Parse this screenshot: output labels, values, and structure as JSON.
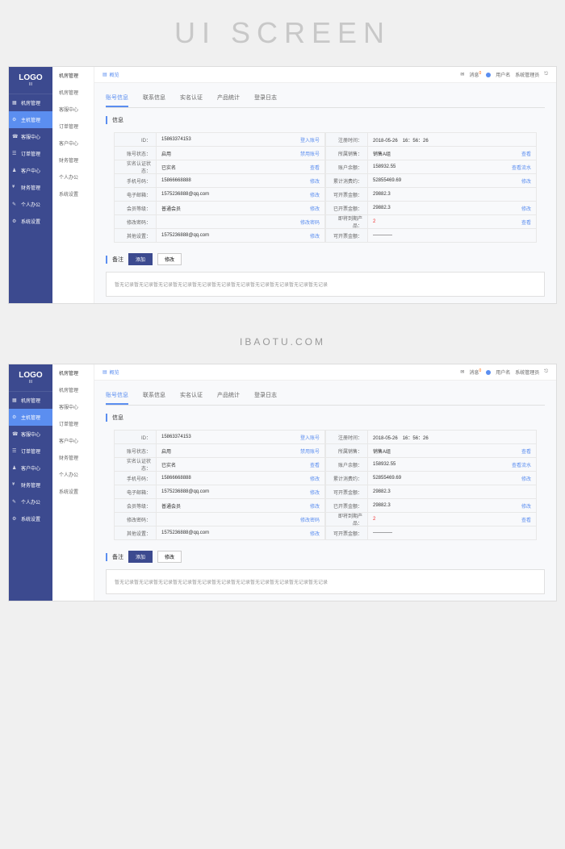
{
  "page_header": "UI SCREEN",
  "page_sub": "IBAOTU.COM",
  "logo": "LOGO",
  "logo_sub": "III",
  "sidebar": {
    "items": [
      {
        "label": "机房管理"
      },
      {
        "label": "主机管理"
      },
      {
        "label": "客服中心"
      },
      {
        "label": "订单管理"
      },
      {
        "label": "客户中心"
      },
      {
        "label": "财务管理"
      },
      {
        "label": "个人办公"
      },
      {
        "label": "系统设置"
      }
    ]
  },
  "subnav": {
    "items": [
      "机房管理",
      "机房管理",
      "客服中心",
      "订单管理",
      "客户中心",
      "财务管理",
      "个人办公",
      "系统设置"
    ]
  },
  "breadcrumb": "概览",
  "topbar": {
    "msg_label": "消息",
    "msg_count": "0",
    "user": "用户名",
    "admin": "系统管理员"
  },
  "tabs": [
    "账号信息",
    "联系信息",
    "实名认证",
    "产品统计",
    "登录日志"
  ],
  "section_title": "信息",
  "left_fields": [
    {
      "label": "ID：",
      "value": "15863374153",
      "action": "登入账号"
    },
    {
      "label": "账号状态：",
      "value": "启用",
      "action": "禁用账号"
    },
    {
      "label": "实名认证状态：",
      "value": "已实名",
      "action": "查看"
    },
    {
      "label": "手机号码：",
      "value": "15866668888",
      "action": "修改"
    },
    {
      "label": "电子邮箱：",
      "value": "1575236888@qq.com",
      "action": "修改"
    },
    {
      "label": "会员等级：",
      "value": "普通会员",
      "action": "修改"
    },
    {
      "label": "修改密码：",
      "value": "",
      "action": "修改密码"
    },
    {
      "label": "其他设置：",
      "value": "1575236888@qq.com",
      "action": "修改"
    }
  ],
  "right_fields": [
    {
      "label": "注册时间：",
      "value": "2018-05-26　16：56：26",
      "action": ""
    },
    {
      "label": "所属销售：",
      "value": "销售A组",
      "action": "查看"
    },
    {
      "label": "账户余额：",
      "value": "158932.55",
      "action": "查看流水"
    },
    {
      "label": "累计消费约：",
      "value": "52855469.69",
      "action": "修改"
    },
    {
      "label": "可开票金额：",
      "value": "29882.3",
      "action": ""
    },
    {
      "label": "已开票金额：",
      "value": "29882.3",
      "action": "修改"
    },
    {
      "label": "即将到期产品：",
      "value": "2",
      "action": "查看",
      "red": true
    },
    {
      "label": "可开票金额：",
      "value": "————",
      "action": ""
    }
  ],
  "remark": {
    "title": "备注",
    "add": "添加",
    "edit": "修改",
    "content": "暂无记录暂无记录暂无记录暂无记录暂无记录暂无记录暂无记录暂无记录暂无记录暂无记录暂无记录"
  }
}
